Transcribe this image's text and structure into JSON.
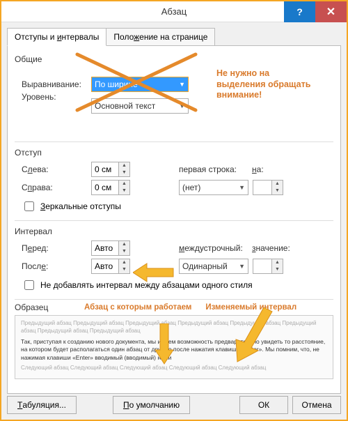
{
  "window": {
    "title": "Абзац",
    "help": "?",
    "close": "✕"
  },
  "tabs": {
    "t1_pre": "Отступы и ",
    "t1_ul": "и",
    "t1_post": "нтервалы",
    "t2_pre": "Поло",
    "t2_ul": "ж",
    "t2_post": "ение на странице"
  },
  "general": {
    "title": "Общие",
    "align_label": "Выравнивание:",
    "align_value": "По ширине",
    "level_label": "Уровень:",
    "level_value": "Основной текст"
  },
  "indent": {
    "title": "Отступ",
    "left_pre": "С",
    "left_ul": "л",
    "left_post": "ева:",
    "left_value": "0 см",
    "right_pre": "С",
    "right_ul": "п",
    "right_post": "рава:",
    "right_value": "0 см",
    "mirror_pre": "",
    "mirror_ul": "З",
    "mirror_post": "еркальные отступы",
    "first_line_label": "первая строка:",
    "first_line_value": "(нет)",
    "on_pre": "",
    "on_ul": "н",
    "on_post": "а:",
    "on_value": ""
  },
  "spacing": {
    "title": "Интервал",
    "before_pre": "П",
    "before_ul": "е",
    "before_post": "ред:",
    "before_value": "Авто",
    "after_pre": "Посл",
    "after_ul": "е",
    "after_post": ":",
    "after_value": "Авто",
    "line_pre": "",
    "line_ul": "м",
    "line_post": "еждустрочный:",
    "line_value": "Одинарный",
    "val_pre": "",
    "val_ul": "з",
    "val_post": "начение:",
    "val_value": "",
    "same_style_label": "Не добавлять интервал между абзацами одного стиля"
  },
  "preview": {
    "title": "Образец",
    "prev_line": "Предыдущий абзац Предыдущий абзац Предыдущий абзац Предыдущий абзац Предыдущий абзац Предыдущий абзац Предыдущий абзац Предыдущий абзац",
    "sample": "Так, приступая к созданию нового документа, мы имеем возможность предварительно увидеть то расстояние, на котором будет располагаться один абзац от другого после нажатия клавиши «Enter». Мы помним, что, не нажимая клавиши «Enter» вводимый (вводимый) нами",
    "next_line": "Следующий абзац Следующий абзац Следующий абзац Следующий абзац Следующий абзац"
  },
  "buttons": {
    "tabs_pre": "",
    "tabs_ul": "Т",
    "tabs_post": "абуляция...",
    "default_pre": "",
    "default_ul": "П",
    "default_post": "о умолчанию",
    "ok": "ОК",
    "cancel": "Отмена"
  },
  "annotations": {
    "note1": "Не нужно на выделения обращать внимание!",
    "note2": "Абзац с которым работаем",
    "note3": "Изменяемый интервал"
  }
}
